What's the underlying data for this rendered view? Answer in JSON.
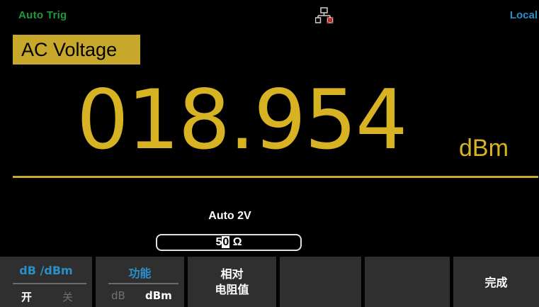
{
  "status": {
    "trigger": "Auto Trig",
    "remote": "Local",
    "network_icon": "lan-disconnected-icon"
  },
  "mode": {
    "label": "AC Voltage"
  },
  "measurement": {
    "value": "018.954",
    "unit": "dBm"
  },
  "range": {
    "label": "Auto 2V"
  },
  "input": {
    "value_digits": "50",
    "cursor_digit": "0",
    "prefix_digit": "5",
    "unit": "Ω"
  },
  "softkeys": {
    "dbm": {
      "title": "dB /dBm",
      "opt_on": "开",
      "opt_off": "关"
    },
    "function": {
      "title": "功能",
      "opt_db": "dB",
      "opt_dbm": "dBm"
    },
    "relative": {
      "line1": "相对",
      "line2": "电阻值"
    },
    "done": {
      "label": "完成"
    }
  },
  "colors": {
    "accent_yellow": "#d7b222",
    "label_bg": "#c8a82a",
    "status_green": "#1f9a3a",
    "status_blue": "#2a8fc8",
    "softkey_bg": "#2f2f2f"
  }
}
